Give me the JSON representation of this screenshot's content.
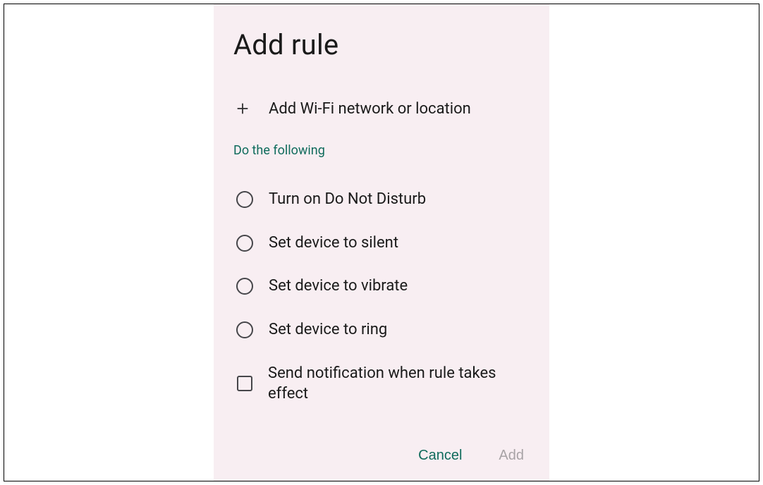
{
  "title": "Add rule",
  "add_row": {
    "label": "Add Wi-Fi network or location"
  },
  "section_header": "Do the following",
  "options": [
    {
      "type": "radio",
      "label": "Turn on Do Not Disturb"
    },
    {
      "type": "radio",
      "label": "Set device to silent"
    },
    {
      "type": "radio",
      "label": "Set device to vibrate"
    },
    {
      "type": "radio",
      "label": "Set device to ring"
    },
    {
      "type": "checkbox",
      "label": "Send notification when rule takes effect"
    }
  ],
  "buttons": {
    "cancel": "Cancel",
    "add": "Add"
  }
}
